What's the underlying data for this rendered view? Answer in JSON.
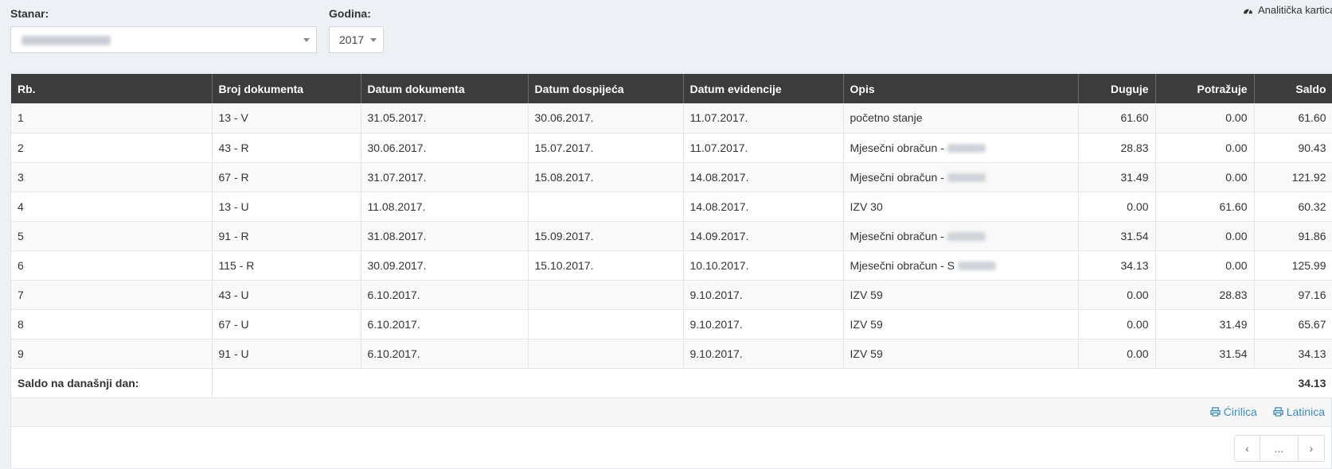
{
  "filters": {
    "tenant_label": "Stanar:",
    "year_label": "Godina:",
    "year_value": "2017"
  },
  "analytic_link": "Analitička kartica",
  "table": {
    "headers": [
      "Rb.",
      "Broj dokumenta",
      "Datum dokumenta",
      "Datum dospijeća",
      "Datum evidencije",
      "Opis",
      "Duguje",
      "Potražuje",
      "Saldo"
    ],
    "rows": [
      [
        "1",
        "13 - V",
        "31.05.2017.",
        "30.06.2017.",
        "11.07.2017.",
        "početno stanje",
        "61.60",
        "0.00",
        "61.60"
      ],
      [
        "2",
        "43 - R",
        "30.06.2017.",
        "15.07.2017.",
        "11.07.2017.",
        "Mjesečni obračun -",
        "28.83",
        "0.00",
        "90.43"
      ],
      [
        "3",
        "67 - R",
        "31.07.2017.",
        "15.08.2017.",
        "14.08.2017.",
        "Mjesečni obračun -",
        "31.49",
        "0.00",
        "121.92"
      ],
      [
        "4",
        "13 - U",
        "11.08.2017.",
        "",
        "14.08.2017.",
        "IZV 30",
        "0.00",
        "61.60",
        "60.32"
      ],
      [
        "5",
        "91 - R",
        "31.08.2017.",
        "15.09.2017.",
        "14.09.2017.",
        "Mjesečni obračun -",
        "31.54",
        "0.00",
        "91.86"
      ],
      [
        "6",
        "115 - R",
        "30.09.2017.",
        "15.10.2017.",
        "10.10.2017.",
        "Mjesečni obračun - S",
        "34.13",
        "0.00",
        "125.99"
      ],
      [
        "7",
        "43 - U",
        "6.10.2017.",
        "",
        "9.10.2017.",
        "IZV 59",
        "0.00",
        "28.83",
        "97.16"
      ],
      [
        "8",
        "67 - U",
        "6.10.2017.",
        "",
        "9.10.2017.",
        "IZV 59",
        "0.00",
        "31.49",
        "65.67"
      ],
      [
        "9",
        "91 - U",
        "6.10.2017.",
        "",
        "9.10.2017.",
        "IZV 59",
        "0.00",
        "31.54",
        "34.13"
      ]
    ],
    "footer_label": "Saldo na današnji dan:",
    "footer_value": "34.13"
  },
  "print": {
    "cyrillic": "Ćirilica",
    "latin": "Latinica"
  },
  "pager": {
    "prev": "‹",
    "mid": "...",
    "next": "›"
  }
}
